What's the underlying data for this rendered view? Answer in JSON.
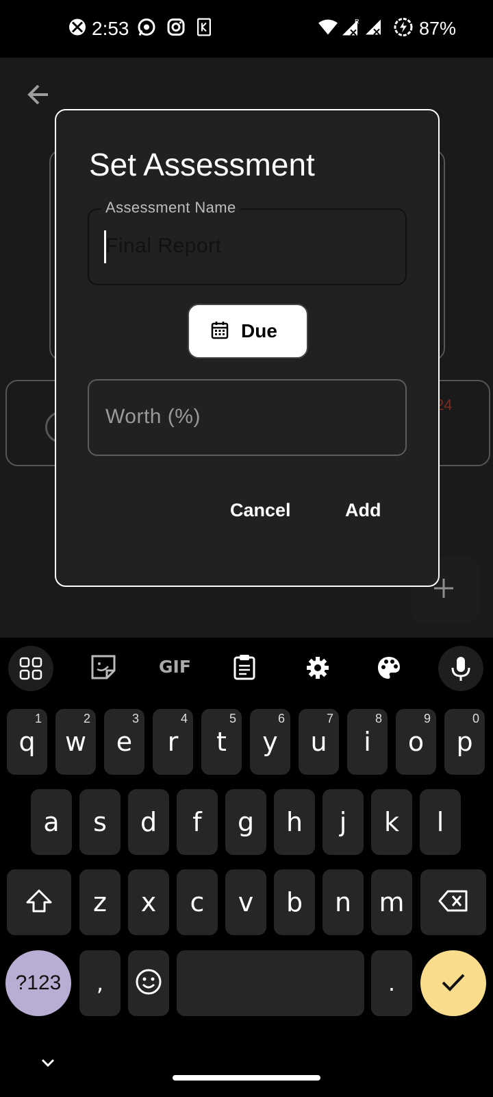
{
  "status_bar": {
    "time": "2:53",
    "battery": "87%",
    "icons": [
      "xbox-icon",
      "whatsapp-icon",
      "instagram-icon",
      "k-app-icon",
      "wifi-icon",
      "signal-r-icon",
      "signal-icon",
      "battery-saver-icon"
    ]
  },
  "background": {
    "partial_text": "24"
  },
  "dialog": {
    "title": "Set Assessment",
    "name_field": {
      "label": "Assessment Name",
      "placeholder": "Final Report"
    },
    "due_button": "Due",
    "worth_field": {
      "placeholder": "Worth (%)"
    },
    "cancel_label": "Cancel",
    "add_label": "Add"
  },
  "keyboard": {
    "toolbar": [
      "apps-grid-icon",
      "sticker-icon",
      "gif-icon",
      "clipboard-icon",
      "settings-icon",
      "theme-palette-icon",
      "mic-icon"
    ],
    "toolbar_gif_label": "GIF",
    "row1": [
      {
        "key": "q",
        "sup": "1"
      },
      {
        "key": "w",
        "sup": "2"
      },
      {
        "key": "e",
        "sup": "3"
      },
      {
        "key": "r",
        "sup": "4"
      },
      {
        "key": "t",
        "sup": "5"
      },
      {
        "key": "y",
        "sup": "6"
      },
      {
        "key": "u",
        "sup": "7"
      },
      {
        "key": "i",
        "sup": "8"
      },
      {
        "key": "o",
        "sup": "9"
      },
      {
        "key": "p",
        "sup": "0"
      }
    ],
    "row2": [
      "a",
      "s",
      "d",
      "f",
      "g",
      "h",
      "j",
      "k",
      "l"
    ],
    "row3": [
      "z",
      "x",
      "c",
      "v",
      "b",
      "n",
      "m"
    ],
    "symbols_key": "?123",
    "comma_key": ",",
    "period_key": ".",
    "colors": {
      "symbols_key": "#b8aed3",
      "enter_key": "#f9dd8d",
      "key_bg": "#262626"
    }
  }
}
